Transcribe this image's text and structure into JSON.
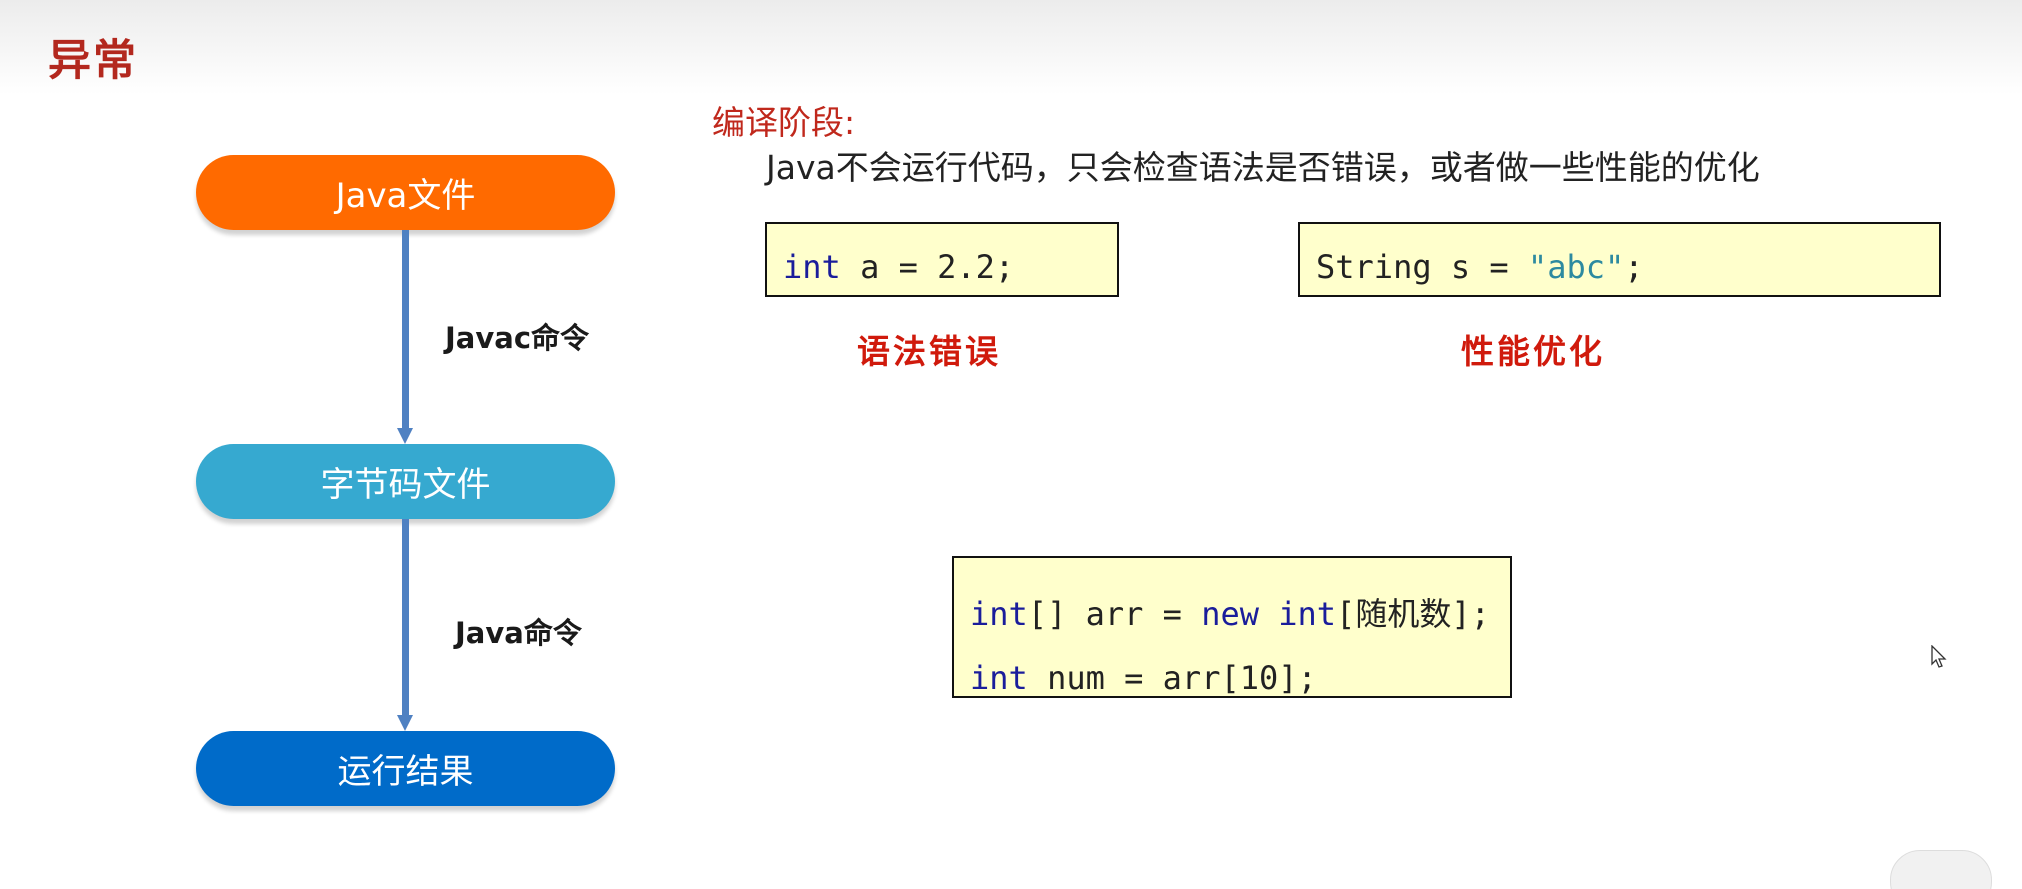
{
  "slide": {
    "title": "异常",
    "colors": {
      "title": "#b3281e",
      "node_java": "#ff6a00",
      "node_bytecode": "#36a9d0",
      "node_result": "#006bc9",
      "connector": "#4f81c2",
      "code_bg": "#ffffcc",
      "keyword": "#1a1d9b",
      "string": "#2d8aa0",
      "caption": "#d01a0c"
    }
  },
  "flow": {
    "nodes": [
      "Java文件",
      "字节码文件",
      "运行结果"
    ],
    "commands": [
      "Javac命令",
      "Java命令"
    ]
  },
  "compile_stage": {
    "heading": "编译阶段:",
    "description": "Java不会运行代码，只会检查语法是否错误，或者做一些性能的优化",
    "example_1": {
      "keyword": "int",
      "rest": " a = 2.2;",
      "caption": "语法错误"
    },
    "example_2": {
      "prefix": "String s = ",
      "string": "\"abc\"",
      "suffix": ";",
      "caption": "性能优化"
    },
    "example_3": {
      "line1_kw1": "int",
      "line1_mid": "[] arr = ",
      "line1_kw2": "new",
      "line1_sp": " ",
      "line1_kw3": "int",
      "line1_end": "[随机数];",
      "line2_kw": "int",
      "line2_rest": " num = arr[10];"
    }
  },
  "icons": {
    "cursor": "mouse-pointer-icon"
  }
}
